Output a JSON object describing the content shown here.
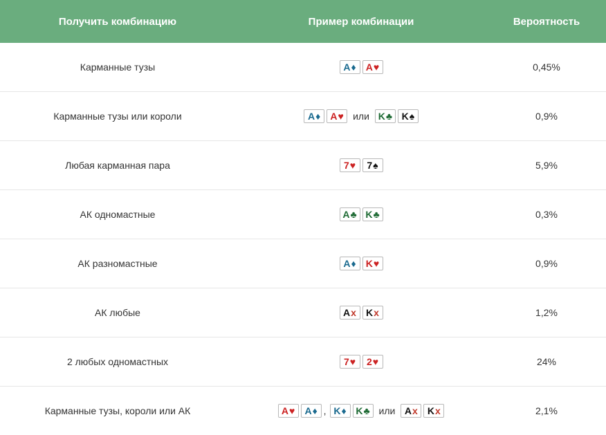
{
  "colors": {
    "header_bg": "#6aad7e",
    "diamond": "#1a6a8f",
    "heart": "#cc2222",
    "club": "#1f6b35",
    "spade": "#111111",
    "x": "#c0392b"
  },
  "header": {
    "col1": "Получить комбинацию",
    "col2": "Пример комбинации",
    "col3": "Вероятность"
  },
  "rows": [
    {
      "label": "Карманные тузы",
      "prob": "0,45%",
      "example": [
        {
          "t": "card",
          "rank": "A",
          "suit": "♦",
          "color": "#1a6a8f"
        },
        {
          "t": "card",
          "rank": "A",
          "suit": "♥",
          "color": "#cc2222"
        }
      ]
    },
    {
      "label": "Карманные тузы или короли",
      "prob": "0,9%",
      "example": [
        {
          "t": "card",
          "rank": "A",
          "suit": "♦",
          "color": "#1a6a8f"
        },
        {
          "t": "card",
          "rank": "A",
          "suit": "♥",
          "color": "#cc2222"
        },
        {
          "t": "sep",
          "text": "или"
        },
        {
          "t": "card",
          "rank": "K",
          "suit": "♣",
          "color": "#1f6b35"
        },
        {
          "t": "card",
          "rank": "K",
          "suit": "♠",
          "color": "#111111"
        }
      ]
    },
    {
      "label": "Любая карманная пара",
      "prob": "5,9%",
      "example": [
        {
          "t": "card",
          "rank": "7",
          "suit": "♥",
          "color": "#cc2222"
        },
        {
          "t": "card",
          "rank": "7",
          "suit": "♠",
          "color": "#111111"
        }
      ]
    },
    {
      "label": "АК одномастные",
      "prob": "0,3%",
      "example": [
        {
          "t": "card",
          "rank": "A",
          "suit": "♣",
          "color": "#1f6b35"
        },
        {
          "t": "card",
          "rank": "K",
          "suit": "♣",
          "color": "#1f6b35"
        }
      ]
    },
    {
      "label": "АК разномастные",
      "prob": "0,9%",
      "example": [
        {
          "t": "card",
          "rank": "A",
          "suit": "♦",
          "color": "#1a6a8f"
        },
        {
          "t": "card",
          "rank": "K",
          "suit": "♥",
          "color": "#cc2222"
        }
      ]
    },
    {
      "label": "АК любые",
      "prob": "1,2%",
      "example": [
        {
          "t": "card",
          "rank": "A",
          "suit": "x",
          "color": "#111111",
          "suitColor": "#c0392b"
        },
        {
          "t": "card",
          "rank": "K",
          "suit": "x",
          "color": "#111111",
          "suitColor": "#c0392b"
        }
      ]
    },
    {
      "label": "2 любых одномастных",
      "prob": "24%",
      "example": [
        {
          "t": "card",
          "rank": "7",
          "suit": "♥",
          "color": "#cc2222"
        },
        {
          "t": "card",
          "rank": "2",
          "suit": "♥",
          "color": "#cc2222"
        }
      ]
    },
    {
      "label": "Карманные тузы, короли или АК",
      "prob": "2,1%",
      "example": [
        {
          "t": "card",
          "rank": "A",
          "suit": "♥",
          "color": "#cc2222"
        },
        {
          "t": "card",
          "rank": "A",
          "suit": "♦",
          "color": "#1a6a8f"
        },
        {
          "t": "comma",
          "text": ","
        },
        {
          "t": "card",
          "rank": "K",
          "suit": "♦",
          "color": "#1a6a8f"
        },
        {
          "t": "card",
          "rank": "K",
          "suit": "♣",
          "color": "#1f6b35"
        },
        {
          "t": "sep",
          "text": "или"
        },
        {
          "t": "card",
          "rank": "A",
          "suit": "x",
          "color": "#111111",
          "suitColor": "#c0392b"
        },
        {
          "t": "card",
          "rank": "K",
          "suit": "x",
          "color": "#111111",
          "suitColor": "#c0392b"
        }
      ]
    }
  ]
}
